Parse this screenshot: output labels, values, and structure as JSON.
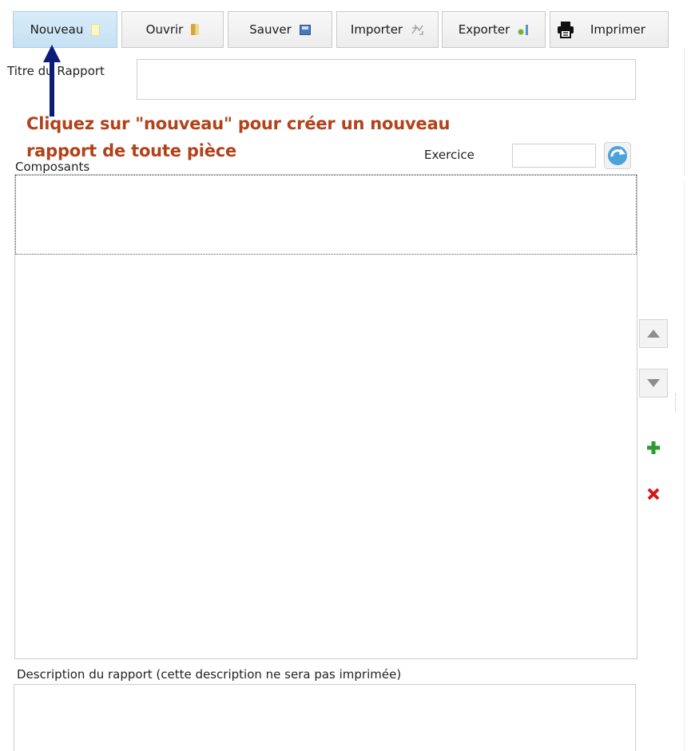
{
  "toolbar": {
    "new_label": "Nouveau",
    "open_label": "Ouvrir",
    "save_label": "Sauver",
    "import_label": "Importer",
    "export_label": "Exporter",
    "print_label": "Imprimer"
  },
  "form": {
    "report_title_label": "Titre du Rapport",
    "report_title_value": "",
    "exercise_label": "Exercice",
    "exercise_value": "",
    "components_label": "Composants",
    "description_label": "Description du rapport (cette  description ne sera pas imprimée)",
    "description_value": ""
  },
  "annotation": {
    "line1": "Cliquez sur \"nouveau\" pour créer un nouveau",
    "line2": "rapport de toute pièce"
  },
  "icons": {
    "new": "new-document-icon",
    "open": "folder-icon",
    "save": "floppy-disk-icon",
    "import": "import-icon",
    "export": "export-icon",
    "print": "printer-icon",
    "refresh": "refresh-icon",
    "move_up": "arrow-up-icon",
    "move_down": "arrow-down-icon",
    "add": "plus-icon",
    "delete": "close-icon"
  },
  "colors": {
    "annotation_text": "#b1421a",
    "annotation_arrow": "#0e1a7a",
    "active_button": "#c6e1f3",
    "add_icon": "#2f9a2f",
    "delete_icon": "#d21a1a"
  }
}
